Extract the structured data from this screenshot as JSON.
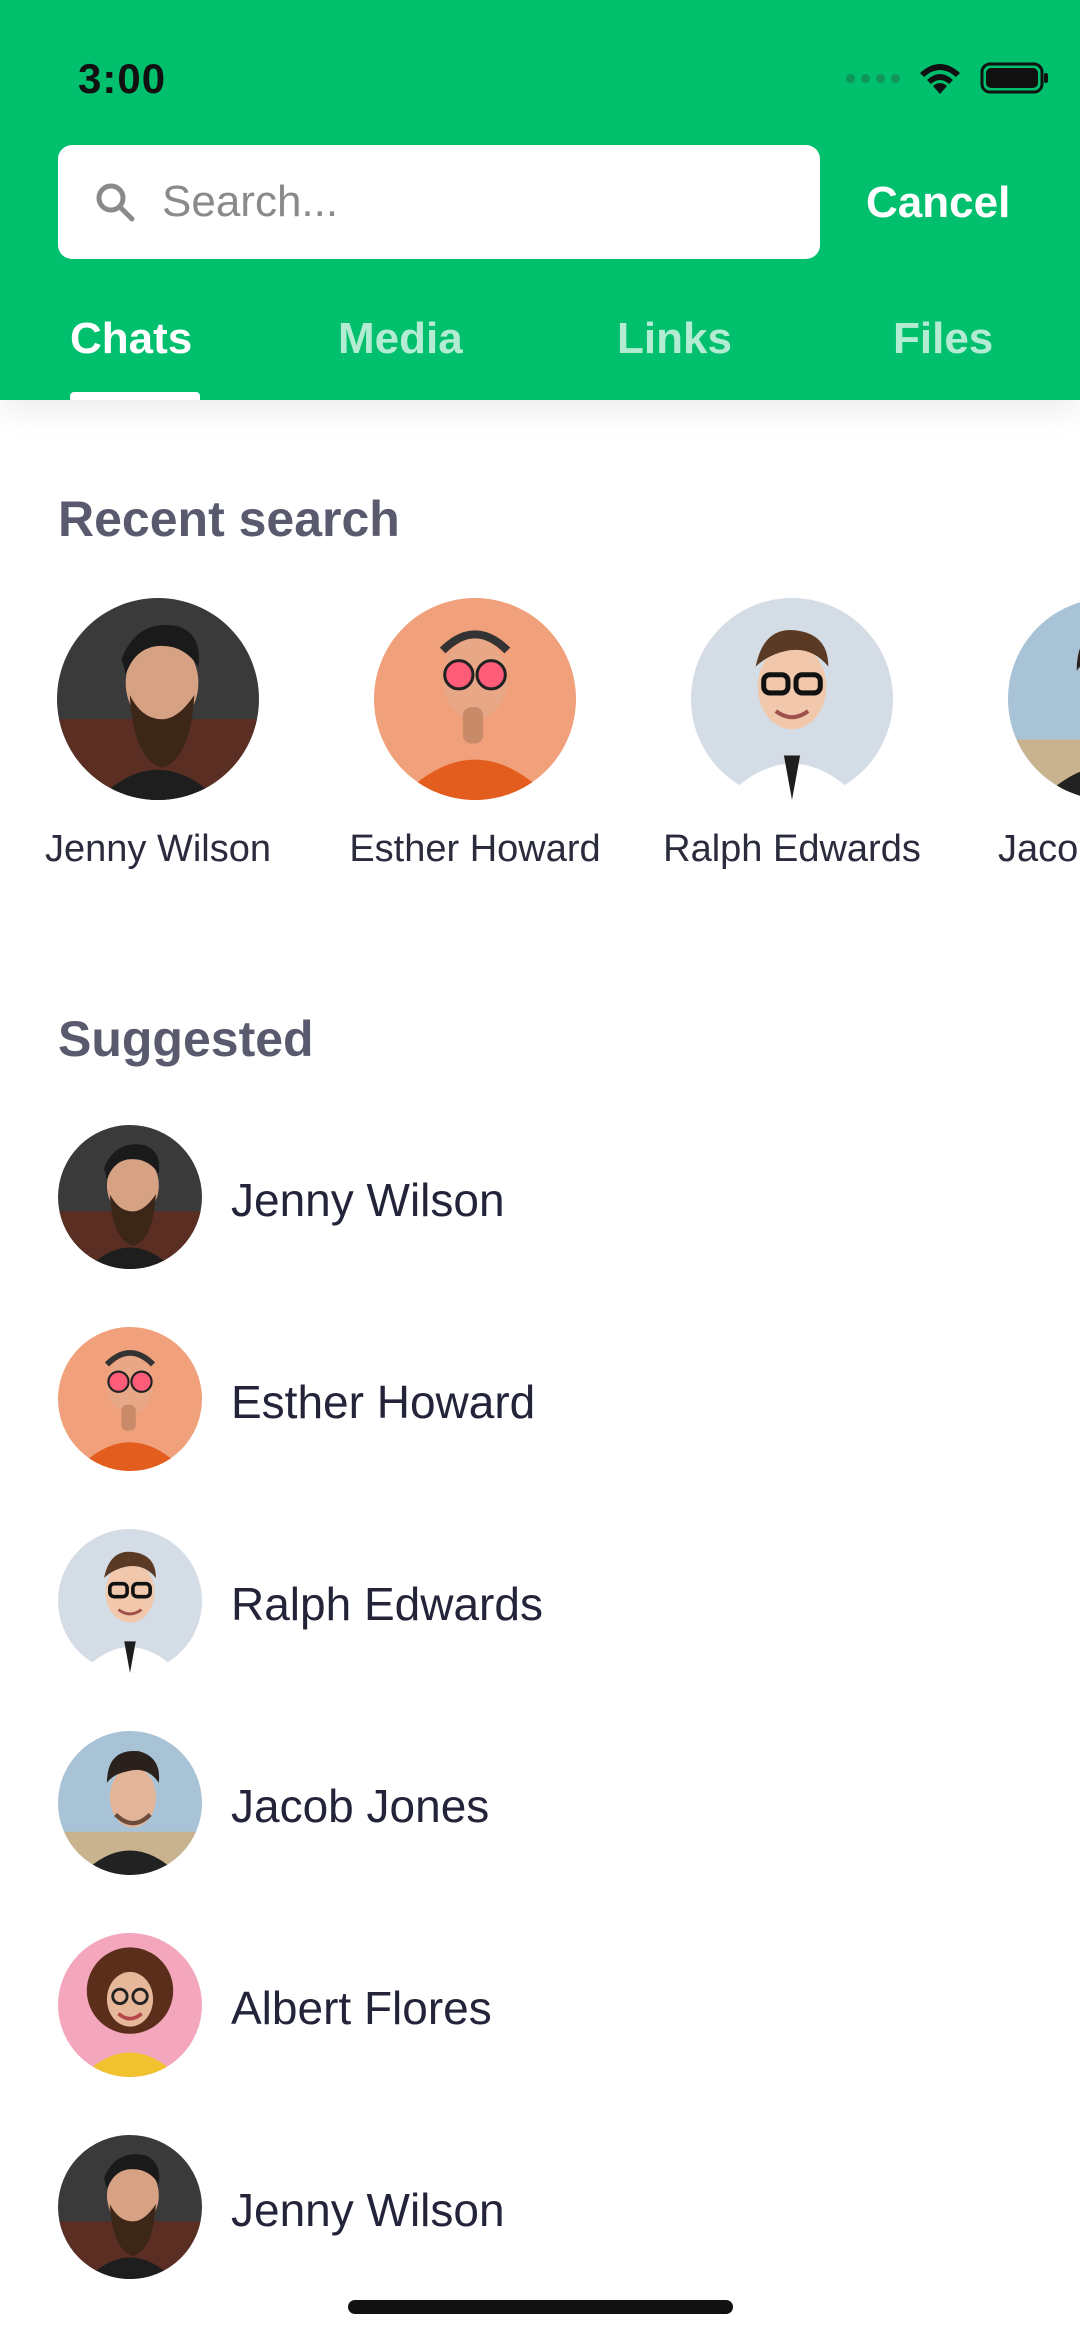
{
  "status_bar": {
    "time": "3:00"
  },
  "search": {
    "placeholder": "Search...",
    "value": "",
    "cancel_label": "Cancel"
  },
  "tabs": [
    {
      "label": "Chats",
      "active": true
    },
    {
      "label": "Media",
      "active": false
    },
    {
      "label": "Links",
      "active": false
    },
    {
      "label": "Files",
      "active": false
    }
  ],
  "recent": {
    "title": "Recent search",
    "items": [
      {
        "name": "Jenny Wilson",
        "avatar": "bearded-man-avatar"
      },
      {
        "name": "Esther Howard",
        "avatar": "orange-hoodie-man-avatar"
      },
      {
        "name": "Ralph Edwards",
        "avatar": "glasses-man-avatar"
      },
      {
        "name": "Jacob Jones",
        "avatar": "stylish-man-avatar"
      }
    ]
  },
  "suggested": {
    "title": "Suggested",
    "items": [
      {
        "name": "Jenny Wilson",
        "avatar": "bearded-man-avatar"
      },
      {
        "name": "Esther Howard",
        "avatar": "orange-hoodie-man-avatar"
      },
      {
        "name": "Ralph Edwards",
        "avatar": "glasses-man-avatar"
      },
      {
        "name": "Jacob Jones",
        "avatar": "stylish-man-avatar"
      },
      {
        "name": "Albert Flores",
        "avatar": "curly-woman-avatar"
      },
      {
        "name": "Jenny Wilson",
        "avatar": "bearded-man-avatar"
      }
    ]
  },
  "colors": {
    "brand": "#00BF6D",
    "section_title": "#595A6D",
    "text": "#23243A"
  }
}
